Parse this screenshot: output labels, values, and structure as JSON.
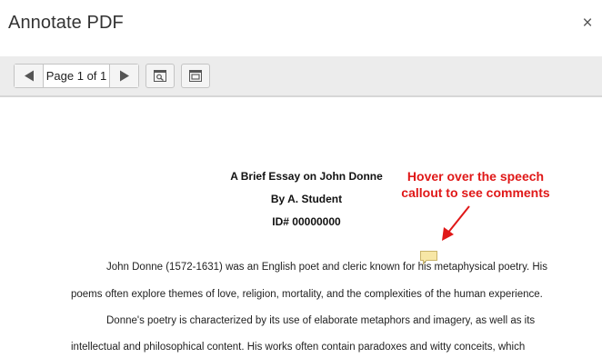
{
  "dialog": {
    "title": "Annotate PDF",
    "close_glyph": "×",
    "close_icon": "close-icon"
  },
  "toolbar": {
    "prev_icon": "triangle-left-icon",
    "page_label": "Page 1 of 1",
    "next_icon": "triangle-right-icon",
    "tool1_icon": "find-icon",
    "tool2_icon": "fullscreen-icon"
  },
  "document": {
    "title": "A Brief Essay on John Donne",
    "author": "By A. Student",
    "id": "ID# 00000000",
    "lines": [
      "John Donne (1572-1631) was an English poet and cleric known for his metaphysical poetry. His",
      "poems often explore themes of love, religion, mortality, and the complexities of the human experience.",
      "Donne's poetry is characterized by its use of elaborate metaphors and imagery, as well as its",
      "intellectual and philosophical content. His works often contain paradoxes and witty conceits, which"
    ]
  },
  "hint": {
    "line1": "Hover over the speech",
    "line2": "callout to see comments",
    "color": "#e01818"
  },
  "callout": {
    "icon": "speech-callout-icon",
    "color": "#f7e7a6"
  }
}
